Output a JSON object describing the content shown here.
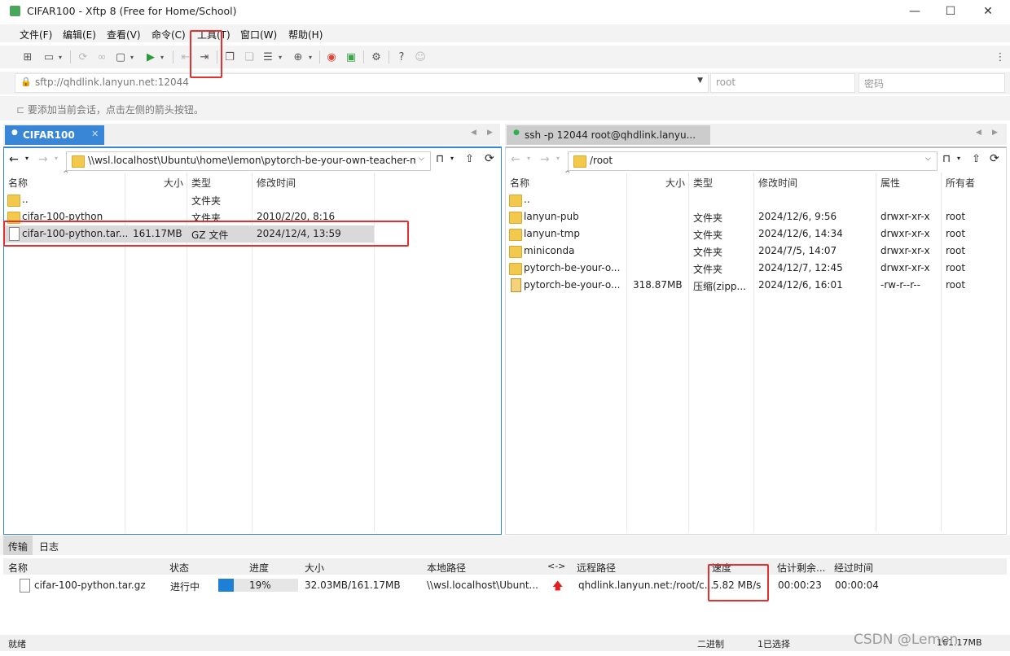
{
  "window": {
    "title": "CIFAR100 - Xftp 8 (Free for Home/School)",
    "minimize": "—",
    "maximize": "☐",
    "close": "✕"
  },
  "menu": [
    "文件(F)",
    "编辑(E)",
    "查看(V)",
    "命令(C)",
    "工具(T)",
    "窗口(W)",
    "帮助(H)"
  ],
  "address": {
    "lock": "🔒",
    "url": "sftp://qhdlink.lanyun.net:12044",
    "user_placeholder": "root",
    "pass_placeholder": "密码"
  },
  "hint": "要添加当前会话，点击左侧的箭头按钮。",
  "left": {
    "tab": "CIFAR100",
    "path": "\\\\wsl.localhost\\Ubuntu\\home\\lemon\\pytorch-be-your-own-teacher-ma",
    "headers": [
      "名称",
      "大小",
      "类型",
      "修改时间"
    ],
    "rows": [
      {
        "name": "..",
        "size": "",
        "type": "文件夹",
        "date": ""
      },
      {
        "name": "cifar-100-python",
        "size": "",
        "type": "文件夹",
        "date": "2010/2/20, 8:16"
      },
      {
        "name": "cifar-100-python.tar...",
        "size": "161.17MB",
        "type": "GZ 文件",
        "date": "2024/12/4, 13:59"
      }
    ]
  },
  "right": {
    "tab": "ssh -p 12044 root@qhdlink.lanyu...",
    "path": "/root",
    "headers": [
      "名称",
      "大小",
      "类型",
      "修改时间",
      "属性",
      "所有者"
    ],
    "rows": [
      {
        "name": "..",
        "size": "",
        "type": "",
        "date": "",
        "attr": "",
        "owner": ""
      },
      {
        "name": "lanyun-pub",
        "size": "",
        "type": "文件夹",
        "date": "2024/12/6, 9:56",
        "attr": "drwxr-xr-x",
        "owner": "root"
      },
      {
        "name": "lanyun-tmp",
        "size": "",
        "type": "文件夹",
        "date": "2024/12/6, 14:34",
        "attr": "drwxr-xr-x",
        "owner": "root"
      },
      {
        "name": "miniconda",
        "size": "",
        "type": "文件夹",
        "date": "2024/7/5, 14:07",
        "attr": "drwxr-xr-x",
        "owner": "root"
      },
      {
        "name": "pytorch-be-your-o...",
        "size": "",
        "type": "文件夹",
        "date": "2024/12/7, 12:45",
        "attr": "drwxr-xr-x",
        "owner": "root"
      },
      {
        "name": "pytorch-be-your-o...",
        "size": "318.87MB",
        "type": "压缩(zipp...",
        "date": "2024/12/6, 16:01",
        "attr": "-rw-r--r--",
        "owner": "root"
      }
    ]
  },
  "bottom": {
    "tabs": [
      "传输",
      "日志"
    ],
    "headers": [
      "名称",
      "状态",
      "进度",
      "大小",
      "本地路径",
      "<->",
      "远程路径",
      "速度",
      "估计剩余...",
      "经过时间"
    ],
    "transfer": {
      "name": "cifar-100-python.tar.gz",
      "status": "进行中",
      "progress": 0.19,
      "progress_text": "19%",
      "size": "32.03MB/161.17MB",
      "local": "\\\\wsl.localhost\\Ubunt...",
      "remote": "qhdlink.lanyun.net:/root/c...",
      "speed": "5.82 MB/s",
      "eta": "00:00:23",
      "elapsed": "00:00:04"
    }
  },
  "status": {
    "left": "就绪",
    "mode": "二进制",
    "selected": "1已选择",
    "size": "161.17MB"
  },
  "watermark": "CSDN @Lemon",
  "colors": {
    "accent": "#3a86d6",
    "highlight": "#e53030",
    "progress": "#1e7fd6",
    "selected_row": "#d9d9d9"
  }
}
